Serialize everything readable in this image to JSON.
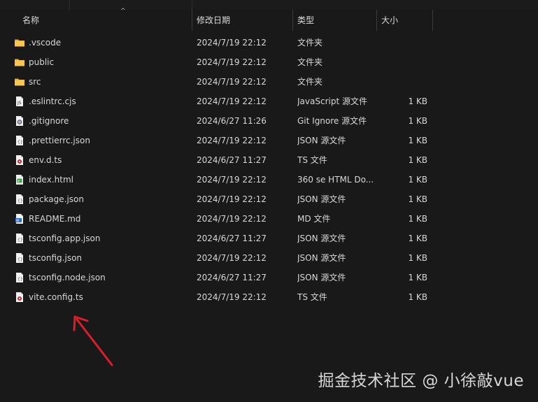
{
  "columns": {
    "name": "名称",
    "date": "修改日期",
    "type": "类型",
    "size": "大小"
  },
  "files": [
    {
      "name": ".vscode",
      "date": "2024/7/19 22:12",
      "type": "文件夹",
      "size": "",
      "icon": "folder-icon"
    },
    {
      "name": "public",
      "date": "2024/7/19 22:12",
      "type": "文件夹",
      "size": "",
      "icon": "folder-icon"
    },
    {
      "name": "src",
      "date": "2024/7/19 22:12",
      "type": "文件夹",
      "size": "",
      "icon": "folder-icon"
    },
    {
      "name": ".eslintrc.cjs",
      "date": "2024/7/19 22:12",
      "type": "JavaScript 源文件",
      "size": "1 KB",
      "icon": "js-file-icon"
    },
    {
      "name": ".gitignore",
      "date": "2024/6/27 11:26",
      "type": "Git Ignore 源文件",
      "size": "1 KB",
      "icon": "gear-file-icon"
    },
    {
      "name": ".prettierrc.json",
      "date": "2024/7/19 22:12",
      "type": "JSON 源文件",
      "size": "1 KB",
      "icon": "json-file-icon"
    },
    {
      "name": "env.d.ts",
      "date": "2024/6/27 11:27",
      "type": "TS 文件",
      "size": "1 KB",
      "icon": "ts-file-icon"
    },
    {
      "name": "index.html",
      "date": "2024/7/19 22:12",
      "type": "360 se HTML Do...",
      "size": "1 KB",
      "icon": "html-file-icon"
    },
    {
      "name": "package.json",
      "date": "2024/7/19 22:12",
      "type": "JSON 源文件",
      "size": "1 KB",
      "icon": "json-file-icon"
    },
    {
      "name": "README.md",
      "date": "2024/7/19 22:12",
      "type": "MD 文件",
      "size": "1 KB",
      "icon": "md-file-icon"
    },
    {
      "name": "tsconfig.app.json",
      "date": "2024/6/27 11:27",
      "type": "JSON 源文件",
      "size": "1 KB",
      "icon": "json-file-icon"
    },
    {
      "name": "tsconfig.json",
      "date": "2024/7/19 22:12",
      "type": "JSON 源文件",
      "size": "1 KB",
      "icon": "json-file-icon"
    },
    {
      "name": "tsconfig.node.json",
      "date": "2024/6/27 11:27",
      "type": "JSON 源文件",
      "size": "1 KB",
      "icon": "json-file-icon"
    },
    {
      "name": "vite.config.ts",
      "date": "2024/7/19 22:12",
      "type": "TS 文件",
      "size": "1 KB",
      "icon": "ts-file-icon"
    }
  ],
  "watermark": "掘金技术社区 @ 小徐敲vue",
  "colors": {
    "background": "#191919",
    "folder": "#f2c04a",
    "arrow": "#d9202a"
  }
}
